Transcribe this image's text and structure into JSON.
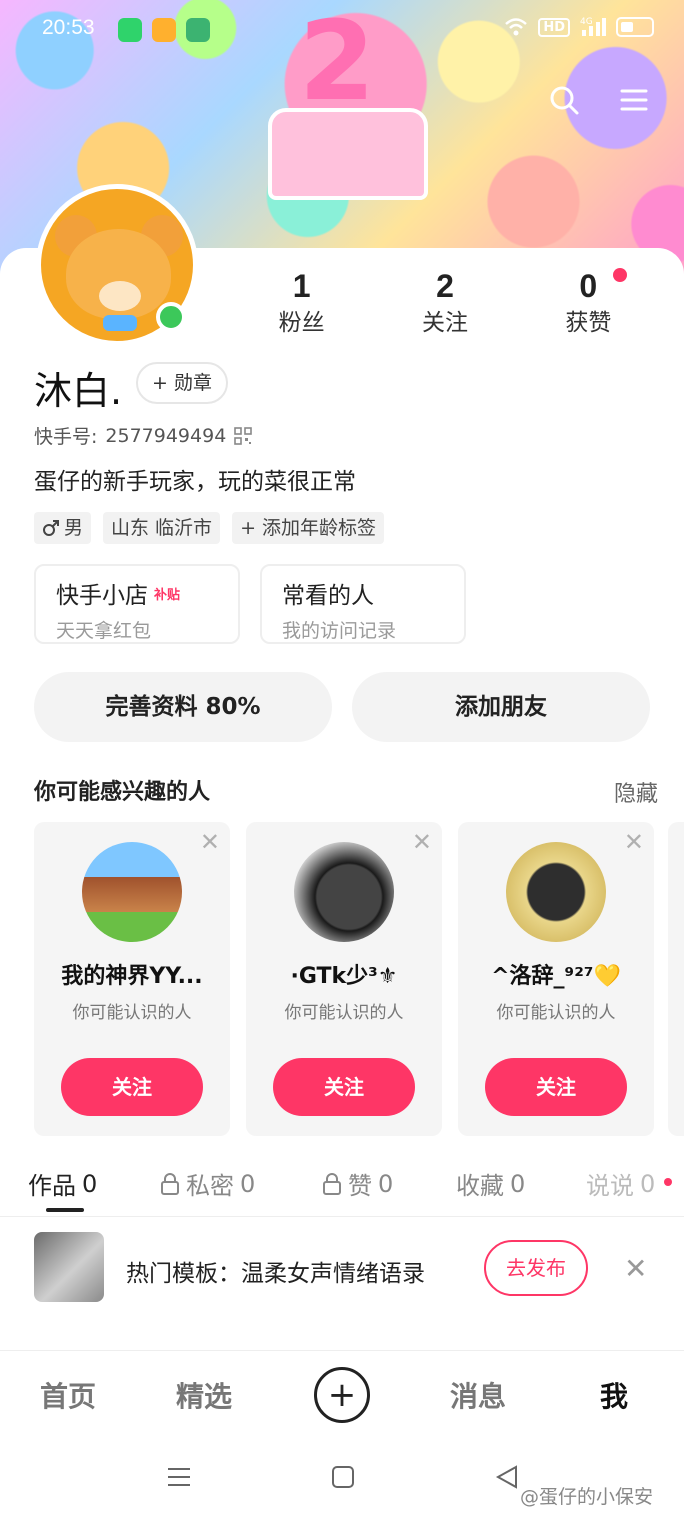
{
  "status_bar": {
    "time": "20:53",
    "network": "4G",
    "hd": "HD"
  },
  "profile": {
    "name": "沐白.",
    "badge_button": "+ 勋章",
    "kwai_id_label": "快手号:",
    "kwai_id": "2577949494",
    "bio": "蛋仔的新手玩家，玩的菜很正常",
    "tags": [
      {
        "icon": "male-icon",
        "label": "男"
      },
      {
        "label": "山东 临沂市"
      },
      {
        "label": "+ 添加年龄标签"
      }
    ]
  },
  "stats": [
    {
      "value": "1",
      "label": "粉丝"
    },
    {
      "value": "2",
      "label": "关注"
    },
    {
      "value": "0",
      "label": "获赞"
    }
  ],
  "shortcuts": [
    {
      "title": "快手小店",
      "tag": "补贴",
      "subtitle": "天天拿红包"
    },
    {
      "title": "常看的人",
      "subtitle": "我的访问记录"
    }
  ],
  "actions": {
    "complete_profile": "完善资料 80%",
    "add_friend": "添加朋友"
  },
  "recommendations": {
    "title": "你可能感兴趣的人",
    "hide": "隐藏",
    "items": [
      {
        "name": "我的神界YY...",
        "subtitle": "你可能认识的人",
        "button": "关注"
      },
      {
        "name": "·GTk少³⚜",
        "subtitle": "你可能认识的人",
        "button": "关注"
      },
      {
        "name": "^洛辞_⁹²⁷💛",
        "subtitle": "你可能认识的人",
        "button": "关注"
      }
    ]
  },
  "tabs": [
    {
      "label": "作品",
      "count": "0",
      "active": true
    },
    {
      "label": "私密",
      "count": "0",
      "locked": true
    },
    {
      "label": "赞",
      "count": "0",
      "locked": true
    },
    {
      "label": "收藏",
      "count": "0"
    },
    {
      "label": "说说",
      "count": "0"
    }
  ],
  "promo": {
    "text": "热门模板：温柔女声情绪语录",
    "button": "去发布"
  },
  "bottom_nav": [
    {
      "label": "首页"
    },
    {
      "label": "精选"
    },
    {
      "label": "+"
    },
    {
      "label": "消息"
    },
    {
      "label": "我",
      "active": true
    }
  ],
  "watermark": "@蛋仔的小保安",
  "colors": {
    "accent": "#fe3666",
    "online": "#3cc85a"
  }
}
